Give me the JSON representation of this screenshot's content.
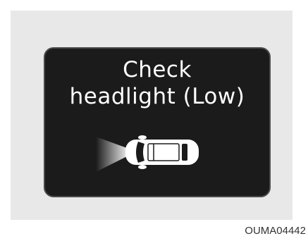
{
  "display": {
    "line1": "Check",
    "line2": "headlight (Low)",
    "icon": "car-headlight-icon"
  },
  "figure_code": "OUMA04442",
  "colors": {
    "screen": "#1b1b1b",
    "text": "#ffffff",
    "outer": "#e8e8e8"
  }
}
